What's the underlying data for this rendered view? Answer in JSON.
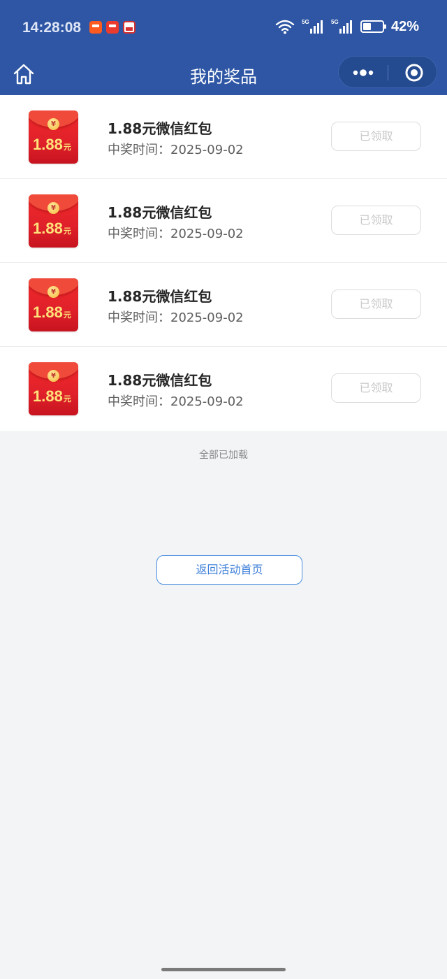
{
  "status_bar": {
    "time": "14:28:08",
    "battery": "42%",
    "icons": [
      "notification-app-icon",
      "notification-app-icon",
      "notification-app-icon",
      "wifi-icon",
      "signal-5g-icon",
      "signal-5g-icon",
      "battery-icon"
    ]
  },
  "nav": {
    "title": "我的奖品",
    "home_icon": "home-icon",
    "more_icon": "more-dots-icon",
    "close_icon": "target-close-icon"
  },
  "prizes": [
    {
      "amount": "1.88",
      "unit": "元",
      "title": "1.88元微信红包",
      "time": "中奖时间：2025-09-02",
      "status": "已领取"
    },
    {
      "amount": "1.88",
      "unit": "元",
      "title": "1.88元微信红包",
      "time": "中奖时间：2025-09-02",
      "status": "已领取"
    },
    {
      "amount": "1.88",
      "unit": "元",
      "title": "1.88元微信红包",
      "time": "中奖时间：2025-09-02",
      "status": "已领取"
    },
    {
      "amount": "1.88",
      "unit": "元",
      "title": "1.88元微信红包",
      "time": "中奖时间：2025-09-02",
      "status": "已领取"
    }
  ],
  "footer": {
    "all_loaded": "全部已加载",
    "return_label": "返回活动首页"
  },
  "colors": {
    "header_bg": "#2e56a4",
    "page_bg": "#f3f4f6",
    "accent_blue": "#3d7fd9",
    "envelope_red": "#e0202a"
  }
}
